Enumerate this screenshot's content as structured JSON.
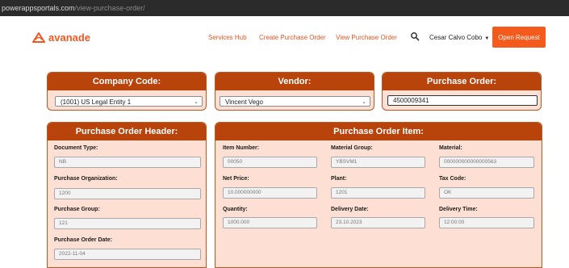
{
  "browser": {
    "url_host": "powerappsportals.com",
    "url_path": "/view-purchase-order/"
  },
  "nav": {
    "brand": "avanade",
    "links": [
      "Services Hub",
      "Create Purchase Order",
      "View Purchase Order"
    ],
    "user": "Cesar Calvo Cobo",
    "open_request": "Open Request"
  },
  "company": {
    "title": "Company Code:",
    "value": "(1001) US Legal Entity 1"
  },
  "vendor": {
    "title": "Vendor:",
    "value": "Vincent Vego"
  },
  "purchase_order": {
    "title": "Purchase Order:",
    "value": "4500009341"
  },
  "header": {
    "title": "Purchase Order Header:",
    "fields": [
      {
        "label": "Document Type:",
        "value": "NB"
      },
      {
        "label": "Purchase Organization:",
        "value": "1200"
      },
      {
        "label": "Purchase Group:",
        "value": "121"
      },
      {
        "label": "Purchase Order Date:",
        "value": "2022-11-04"
      }
    ]
  },
  "item": {
    "title": "Purchase Order Item:",
    "fields": [
      {
        "label": "Item Number:",
        "value": "00050"
      },
      {
        "label": "Material Group:",
        "value": "YBSVM1"
      },
      {
        "label": "Material:",
        "value": "000000000000000563"
      },
      {
        "label": "Net Price:",
        "value": "10.000000000"
      },
      {
        "label": "Plant:",
        "value": "1201"
      },
      {
        "label": "Tax Code:",
        "value": "OK"
      },
      {
        "label": "Quantity:",
        "value": "1000.000"
      },
      {
        "label": "Delivery Date:",
        "value": "23.10.2023"
      },
      {
        "label": "Delivery Time:",
        "value": "12:00:00"
      }
    ]
  },
  "colors": {
    "brand": "#f05a22",
    "panel_header": "#b8440c",
    "panel_body": "#fde0d3",
    "button": "#f35a1c"
  },
  "icons": {
    "logo": "avanade-logo-icon",
    "search": "search-icon",
    "dropdown": "chevron-down-icon"
  }
}
